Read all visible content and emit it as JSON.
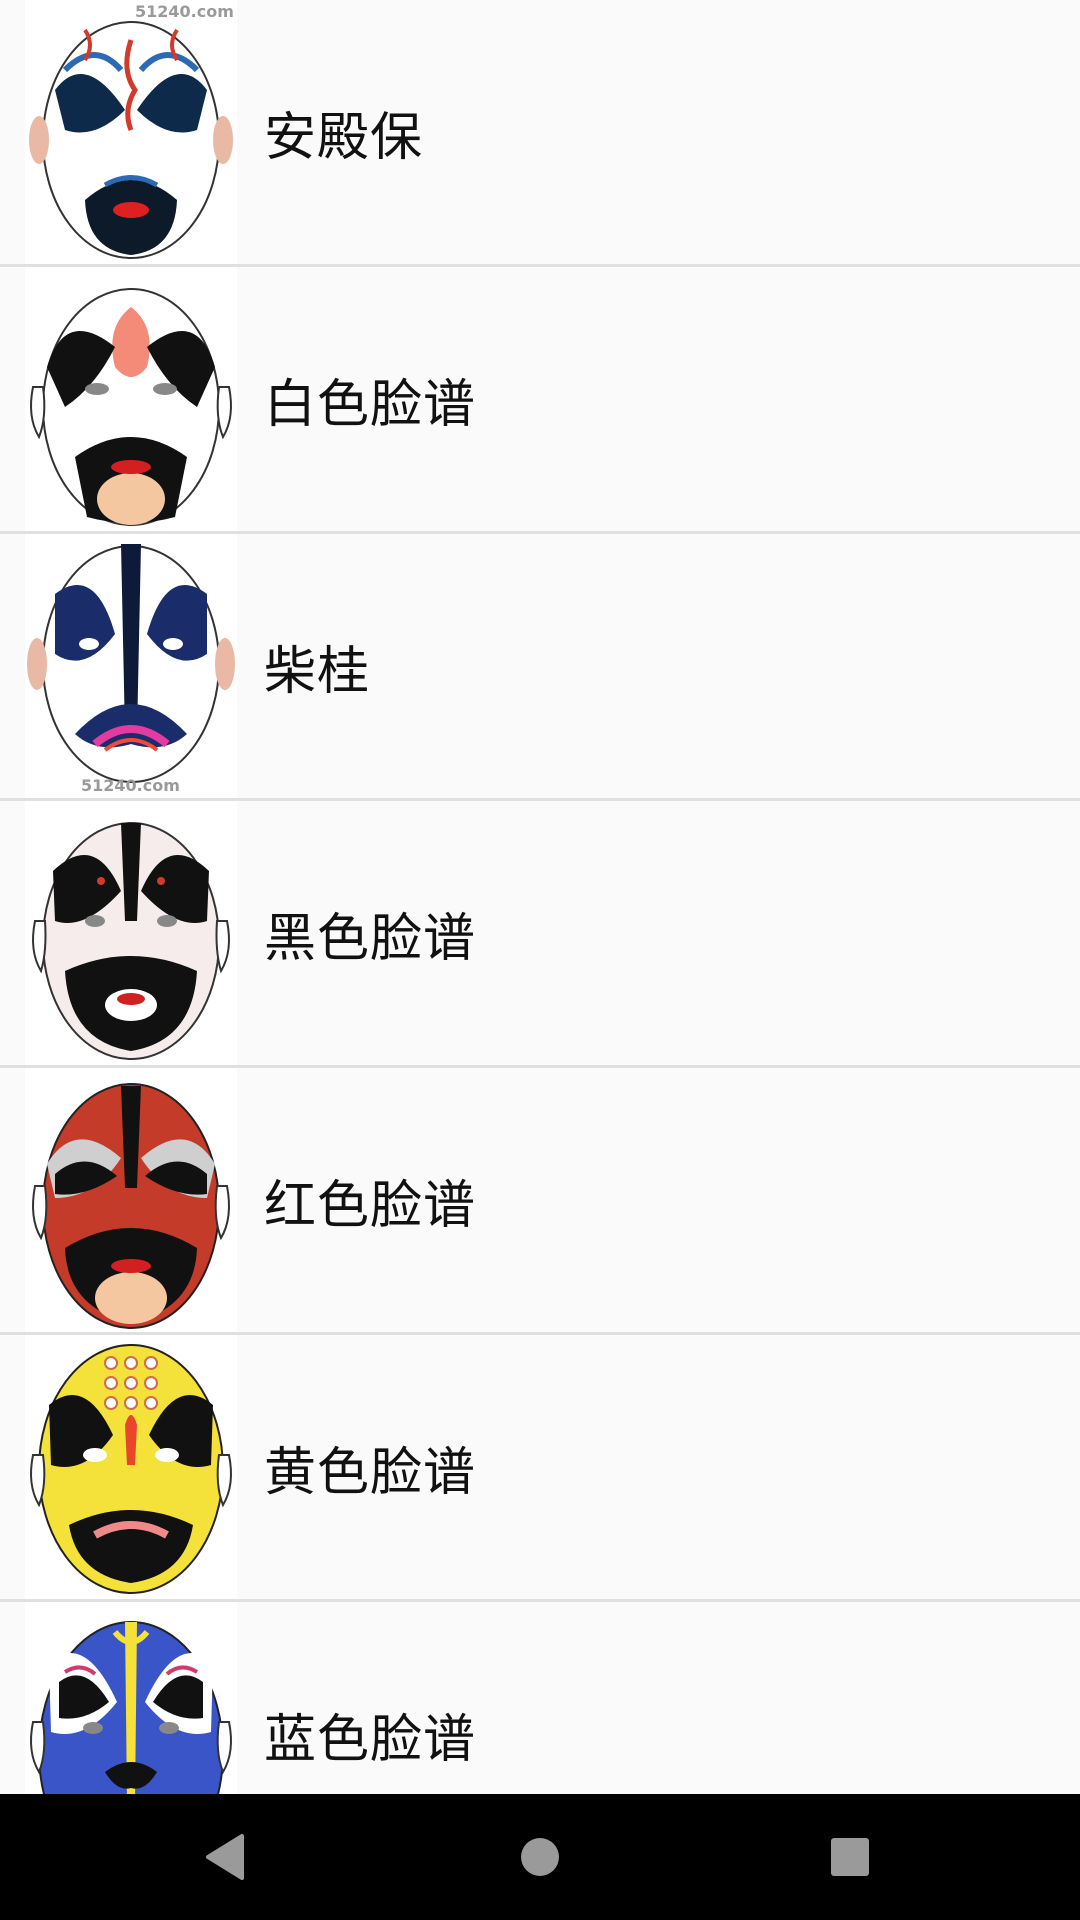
{
  "list": {
    "items": [
      {
        "label": "安殿保",
        "watermark_top": "51240.com",
        "face": "blue-white"
      },
      {
        "label": "白色脸谱",
        "face": "white"
      },
      {
        "label": "柴桂",
        "watermark_bottom": "51240.com",
        "face": "blue-white-2"
      },
      {
        "label": "黑色脸谱",
        "face": "black"
      },
      {
        "label": "红色脸谱",
        "face": "red"
      },
      {
        "label": "黄色脸谱",
        "face": "yellow"
      },
      {
        "label": "蓝色脸谱",
        "face": "blue"
      }
    ]
  },
  "navbar": {
    "back_icon": "back-triangle-icon",
    "home_icon": "home-circle-icon",
    "recents_icon": "recents-square-icon",
    "color": "#000000"
  },
  "colors": {
    "background": "#fafafa",
    "divider": "#e0e0e0",
    "text": "#111111"
  }
}
